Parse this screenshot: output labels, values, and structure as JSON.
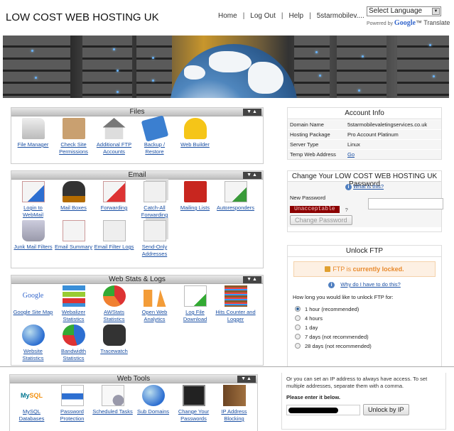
{
  "header": {
    "title": "LOW COST WEB HOSTING UK",
    "nav": [
      "Home",
      "Log Out",
      "Help",
      "5starmobilev...."
    ],
    "language_select": "Select Language",
    "powered_by": "Powered by",
    "google": "Google",
    "translate": "™ Translate"
  },
  "sections": {
    "files": {
      "title": "Files",
      "items": [
        {
          "label": "File Manager",
          "icon": "folder-icon"
        },
        {
          "label": "Check Site Permissions",
          "icon": "clipboard-check-icon"
        },
        {
          "label": "Additional FTP Accounts",
          "icon": "house-add-icon"
        },
        {
          "label": "Backup / Restore",
          "icon": "floppy-disk-icon"
        },
        {
          "label": "Web Builder",
          "icon": "hard-hat-icon"
        }
      ]
    },
    "email": {
      "title": "Email",
      "items": [
        {
          "label": "Login to WebMail",
          "icon": "envelope-globe-icon"
        },
        {
          "label": "Mail Boxes",
          "icon": "mailbox-icon"
        },
        {
          "label": "Forwarding",
          "icon": "envelope-forward-icon"
        },
        {
          "label": "Catch-All Forwarding",
          "icon": "envelopes-icon"
        },
        {
          "label": "Mailing Lists",
          "icon": "address-book-icon"
        },
        {
          "label": "Autoresponders",
          "icon": "envelope-refresh-icon"
        },
        {
          "label": "Junk Mail Filters",
          "icon": "recycle-bin-icon"
        },
        {
          "label": "Email Summary",
          "icon": "envelope-list-icon"
        },
        {
          "label": "Email Filter Logs",
          "icon": "envelope-search-icon"
        },
        {
          "label": "Send-Only Addresses",
          "icon": "envelopes-stack-icon"
        }
      ]
    },
    "webstats": {
      "title": "Web Stats & Logs",
      "items": [
        {
          "label": "Google Site Map",
          "icon": "google-icon"
        },
        {
          "label": "Webalizer Statistics",
          "icon": "bar-chart-icon"
        },
        {
          "label": "AWStats Statistics",
          "icon": "pie-chart-icon"
        },
        {
          "label": "Open Web Analytics",
          "icon": "owa-icon"
        },
        {
          "label": "Log File Download",
          "icon": "file-download-icon"
        },
        {
          "label": "Hits Counter and Logger",
          "icon": "abacus-icon"
        },
        {
          "label": "Website Statistics",
          "icon": "globe-search-icon"
        },
        {
          "label": "Bandwidth Statistics",
          "icon": "pie-chart-window-icon"
        },
        {
          "label": "Tracewatch",
          "icon": "binoculars-icon"
        }
      ]
    },
    "webtools": {
      "title": "Web Tools",
      "items": [
        {
          "label": "MySQL Databases",
          "icon": "mysql-icon"
        },
        {
          "label": "Password Protection",
          "icon": "padlock-file-icon"
        },
        {
          "label": "Scheduled Tasks",
          "icon": "clock-file-icon"
        },
        {
          "label": "Sub Domains",
          "icon": "globe-icon"
        },
        {
          "label": "Change Your Passwords",
          "icon": "login-screen-icon"
        },
        {
          "label": "IP Address Blocking",
          "icon": "wooden-block-icon"
        }
      ]
    }
  },
  "account_info": {
    "title": "Account Info",
    "rows": [
      {
        "label": "Domain Name",
        "value": "5starmobilevaletingservices.co.uk"
      },
      {
        "label": "Hosting Package",
        "value": "Pro Account Platinum"
      },
      {
        "label": "Server Type",
        "value": "Linux"
      },
      {
        "label": "Temp Web Address",
        "value": "Go"
      }
    ]
  },
  "change_password": {
    "title": "Change Your LOW COST WEB HOSTING UK Password",
    "what_is_this": "What is this?",
    "new_password_label": "New Password",
    "new_password_value": "",
    "strength": "Unacceptable",
    "help": "?",
    "button": "Change Password"
  },
  "unlock_ftp": {
    "title": "Unlock FTP",
    "status_prefix": "FTP is ",
    "status_bold": "currently locked.",
    "why_link": "Why do I have to do this?",
    "question": "How long you would like to unlock FTP for:",
    "options": [
      {
        "label": "1 hour (recommended)",
        "selected": true
      },
      {
        "label": "4 hours",
        "selected": false
      },
      {
        "label": "1 day",
        "selected": false
      },
      {
        "label": "7 days (not recommended)",
        "selected": false
      },
      {
        "label": "28 days (not recommended)",
        "selected": false
      }
    ],
    "ip_text": "Or you can set an IP address to always have access. To set multiple addresses, separate them with a comma.",
    "enter_label": "Please enter it below.",
    "ip_button": "Unlock by IP"
  },
  "colors": {
    "link": "#1a4fa3",
    "unacceptable_bg": "#8b0000",
    "locked_text": "#e8892b",
    "locked_bg": "#fdf0e3"
  }
}
